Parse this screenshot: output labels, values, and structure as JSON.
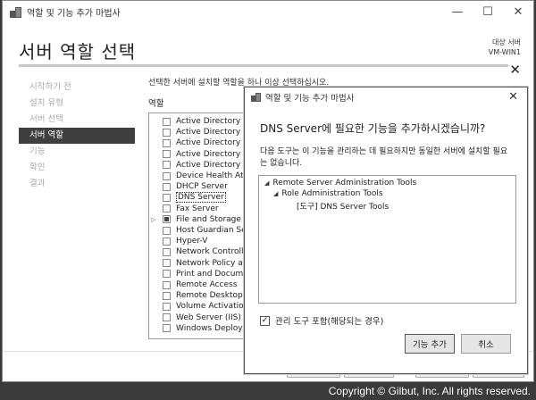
{
  "window": {
    "title": "역할 및 기능 추가 마법사",
    "controls": [
      "—",
      "☐",
      "✕"
    ]
  },
  "header": {
    "page_title": "서버 역할 선택",
    "destination_label": "대상 서버",
    "destination_server": "VM-WIN1"
  },
  "nav": {
    "items": [
      {
        "label": "시작하기 전",
        "active": false
      },
      {
        "label": "설치 유형",
        "active": false
      },
      {
        "label": "서버 선택",
        "active": false
      },
      {
        "label": "서버 역할",
        "active": true
      },
      {
        "label": "기능",
        "active": false
      },
      {
        "label": "확인",
        "active": false
      },
      {
        "label": "결과",
        "active": false
      }
    ]
  },
  "main": {
    "instruction": "선택한 서버에 설치할 역할을 하나 이상 선택하십시오.",
    "roles_label": "역할",
    "roles": [
      {
        "label": "Active Directory Ce",
        "state": "unchecked"
      },
      {
        "label": "Active Directory Do",
        "state": "unchecked"
      },
      {
        "label": "Active Directory Fe",
        "state": "unchecked"
      },
      {
        "label": "Active Directory Lig",
        "state": "unchecked"
      },
      {
        "label": "Active Directory Rig",
        "state": "unchecked"
      },
      {
        "label": "Device Health Atte",
        "state": "unchecked"
      },
      {
        "label": "DHCP Server",
        "state": "unchecked"
      },
      {
        "label": "DNS Server",
        "state": "unchecked",
        "selected": true
      },
      {
        "label": "Fax Server",
        "state": "unchecked"
      },
      {
        "label": "File and Storage Se",
        "state": "partial",
        "expandable": true
      },
      {
        "label": "Host Guardian Ser",
        "state": "unchecked"
      },
      {
        "label": "Hyper-V",
        "state": "unchecked"
      },
      {
        "label": "Network Controlle",
        "state": "unchecked"
      },
      {
        "label": "Network Policy and",
        "state": "unchecked"
      },
      {
        "label": "Print and Docume",
        "state": "unchecked"
      },
      {
        "label": "Remote Access",
        "state": "unchecked"
      },
      {
        "label": "Remote Desktop S",
        "state": "unchecked"
      },
      {
        "label": "Volume Activation",
        "state": "unchecked"
      },
      {
        "label": "Web Server (IIS)",
        "state": "unchecked"
      },
      {
        "label": "Windows Deploym",
        "state": "unchecked"
      }
    ]
  },
  "dialog": {
    "title": "역할 및 기능 추가 마법사",
    "close": "✕",
    "question": "DNS Server에 필요한 기능을 추가하시겠습니까?",
    "description": "다음 도구는 이 기능을 관리하는 데 필요하지만 동일한 서버에 설치할 필요는 없습니다.",
    "tree": [
      {
        "label": "Remote Server Administration Tools",
        "level": 0,
        "expanded": true
      },
      {
        "label": "Role Administration Tools",
        "level": 1,
        "expanded": true
      },
      {
        "label": "[도구] DNS Server Tools",
        "level": 2
      }
    ],
    "include_tools_label": "관리 도구 포함(해당되는 경우)",
    "include_tools_checked": true,
    "add_features_button": "기능 추가",
    "cancel_button": "취소"
  },
  "copyright": "Copyright © Gilbut, Inc. All rights reserved."
}
